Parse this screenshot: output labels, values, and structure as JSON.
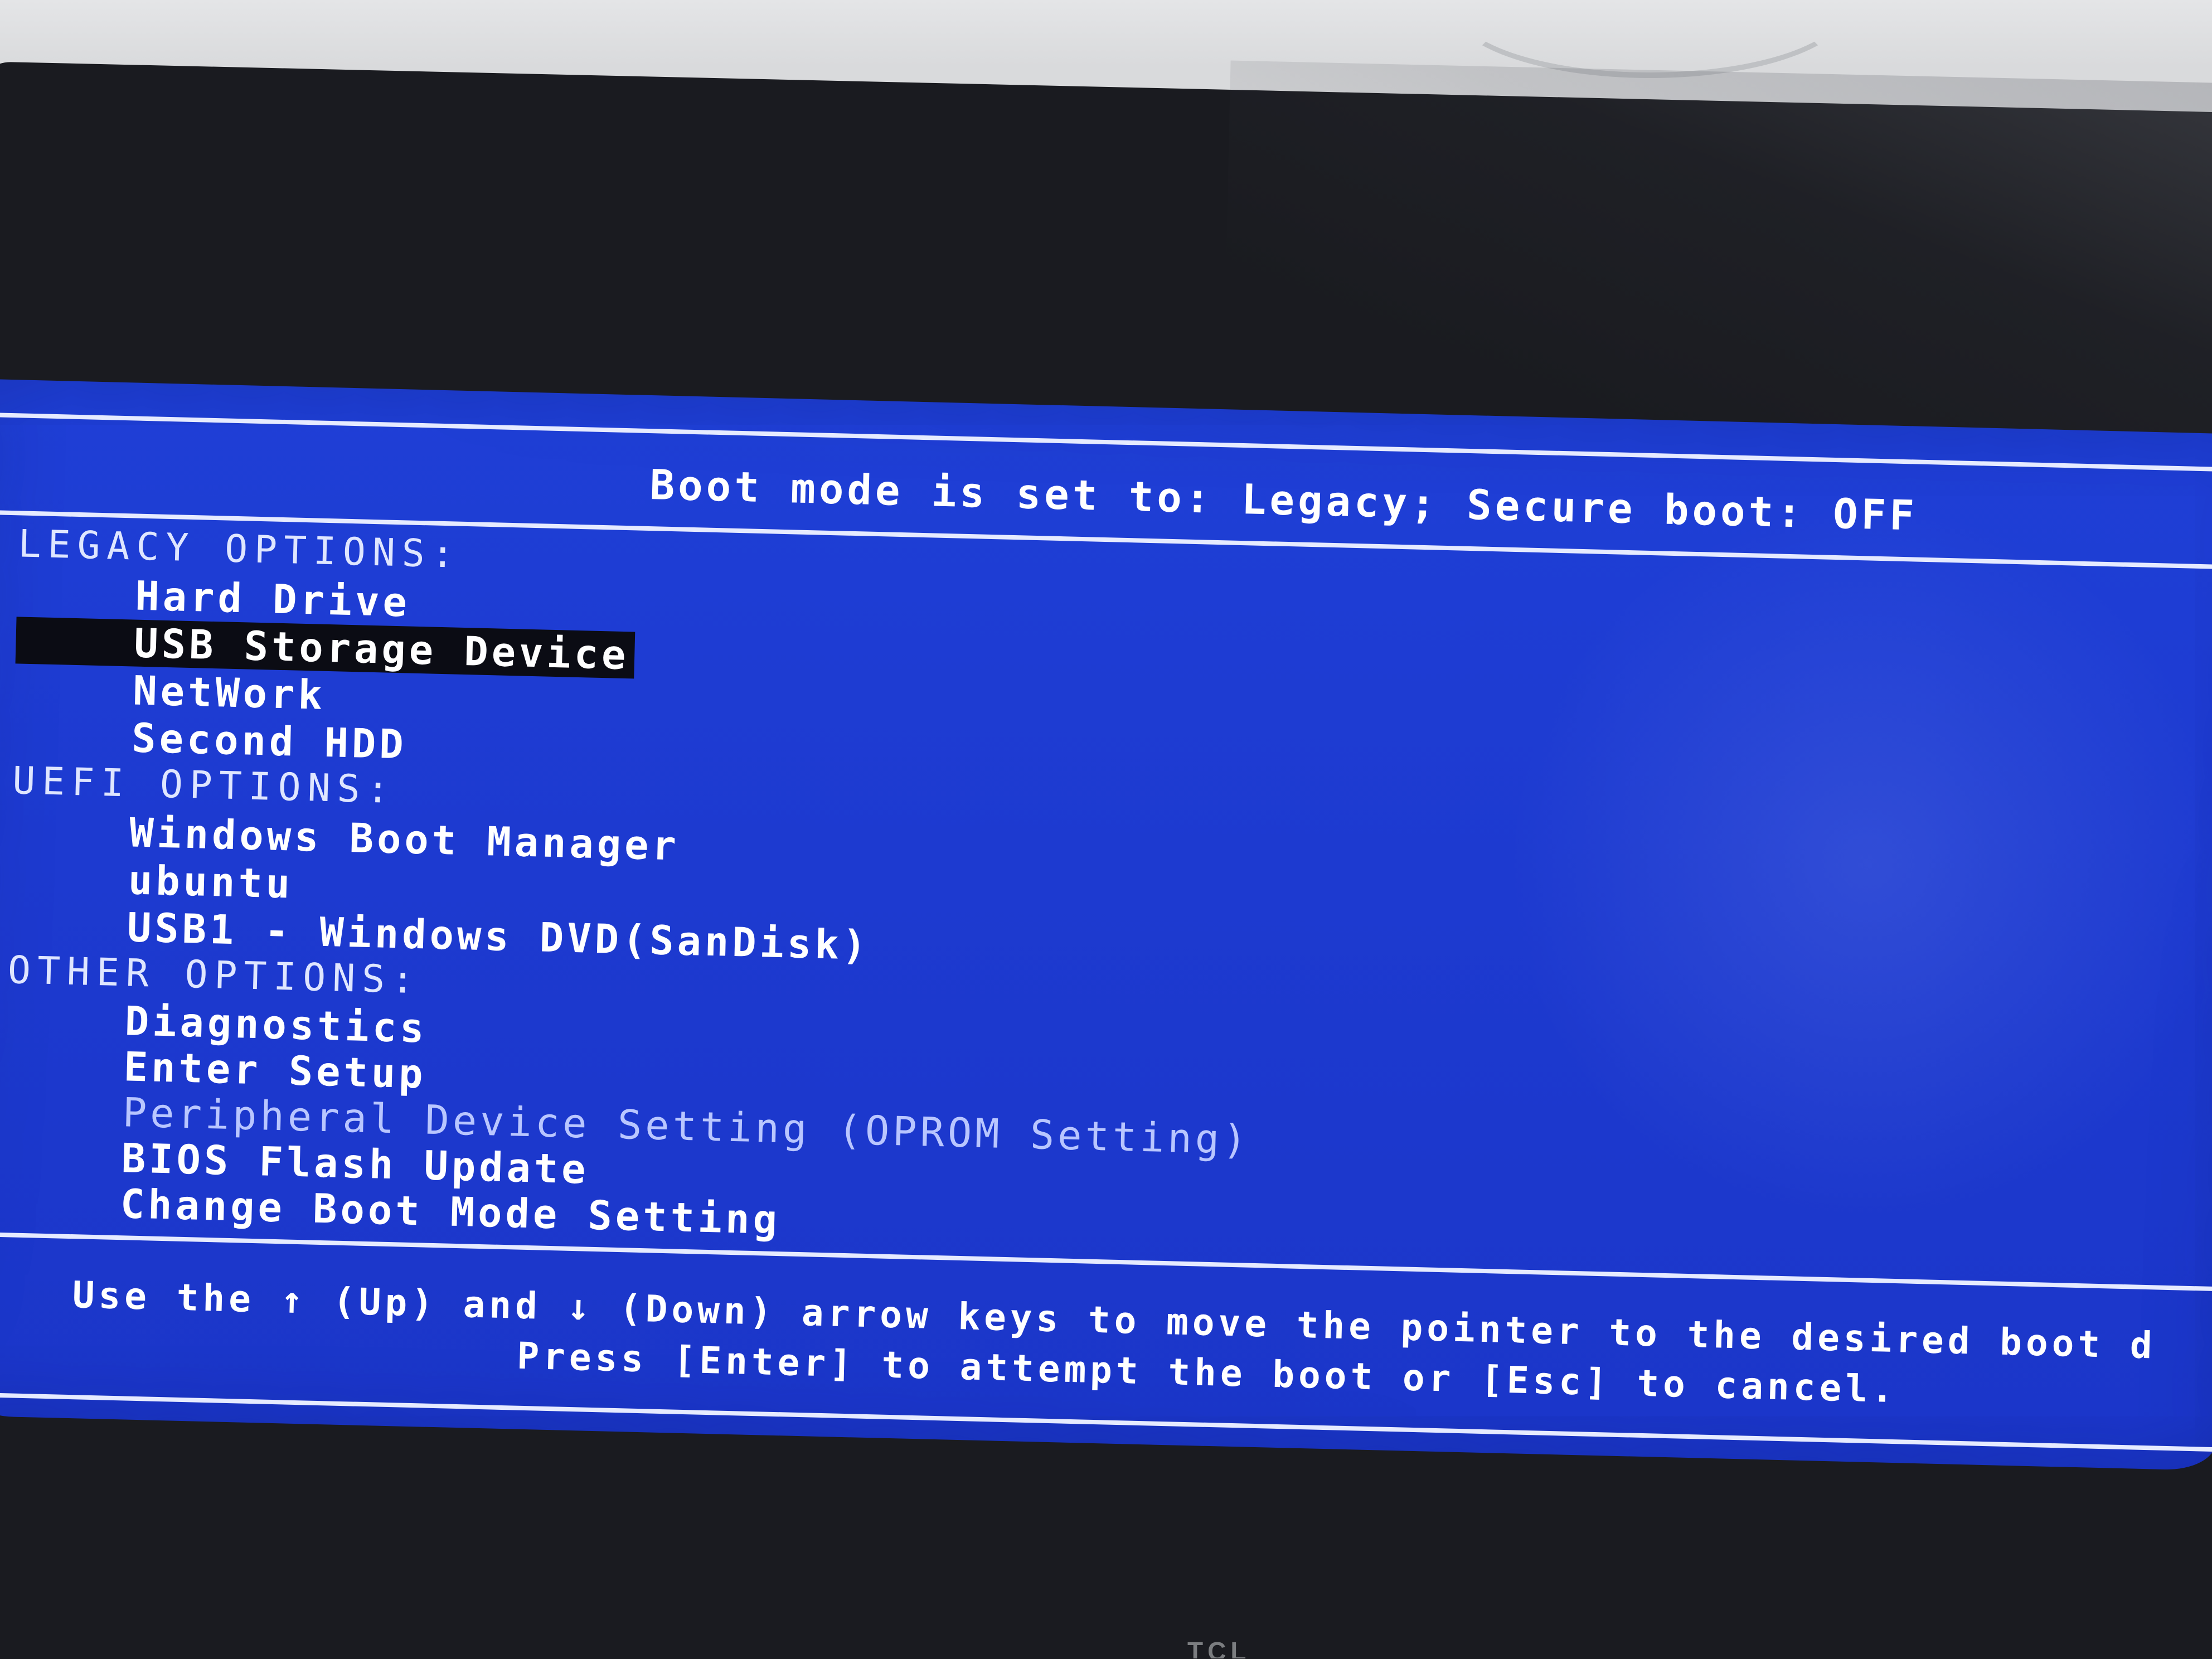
{
  "header": {
    "boot_mode_line": "Boot mode is set to: Legacy; Secure boot: OFF"
  },
  "sections": [
    {
      "heading": "LEGACY OPTIONS:",
      "items": [
        {
          "label": "Hard Drive",
          "state": "normal"
        },
        {
          "label": "USB Storage Device",
          "state": "selected"
        },
        {
          "label": "NetWork",
          "state": "normal"
        },
        {
          "label": "Second HDD",
          "state": "normal"
        }
      ]
    },
    {
      "heading": "UEFI OPTIONS:",
      "items": [
        {
          "label": "Windows Boot Manager",
          "state": "normal"
        },
        {
          "label": "ubuntu",
          "state": "normal"
        },
        {
          "label": "USB1 - Windows DVD(SanDisk)",
          "state": "normal"
        }
      ]
    },
    {
      "heading": "OTHER OPTIONS:",
      "items": [
        {
          "label": "Diagnostics",
          "state": "normal"
        },
        {
          "label": "Enter Setup",
          "state": "normal"
        },
        {
          "label": "Peripheral Device Setting (OPROM Setting)",
          "state": "disabled"
        },
        {
          "label": "BIOS Flash Update",
          "state": "normal"
        },
        {
          "label": "Change Boot Mode Setting",
          "state": "normal"
        }
      ]
    }
  ],
  "footer": {
    "help_line_1": "Use the ↑ (Up) and ↓ (Down) arrow keys to move the pointer to the desired boot d",
    "help_line_2": "Press [Enter] to attempt the boot or [Esc] to cancel."
  },
  "monitor": {
    "brand_fragment": "TCL"
  },
  "colors": {
    "screen_background": "#1d3ad0",
    "text": "#ffffff",
    "selected_background": "#0b0c14",
    "disabled_text": "#b9c6ff",
    "border_lines": "#e6ebff"
  }
}
